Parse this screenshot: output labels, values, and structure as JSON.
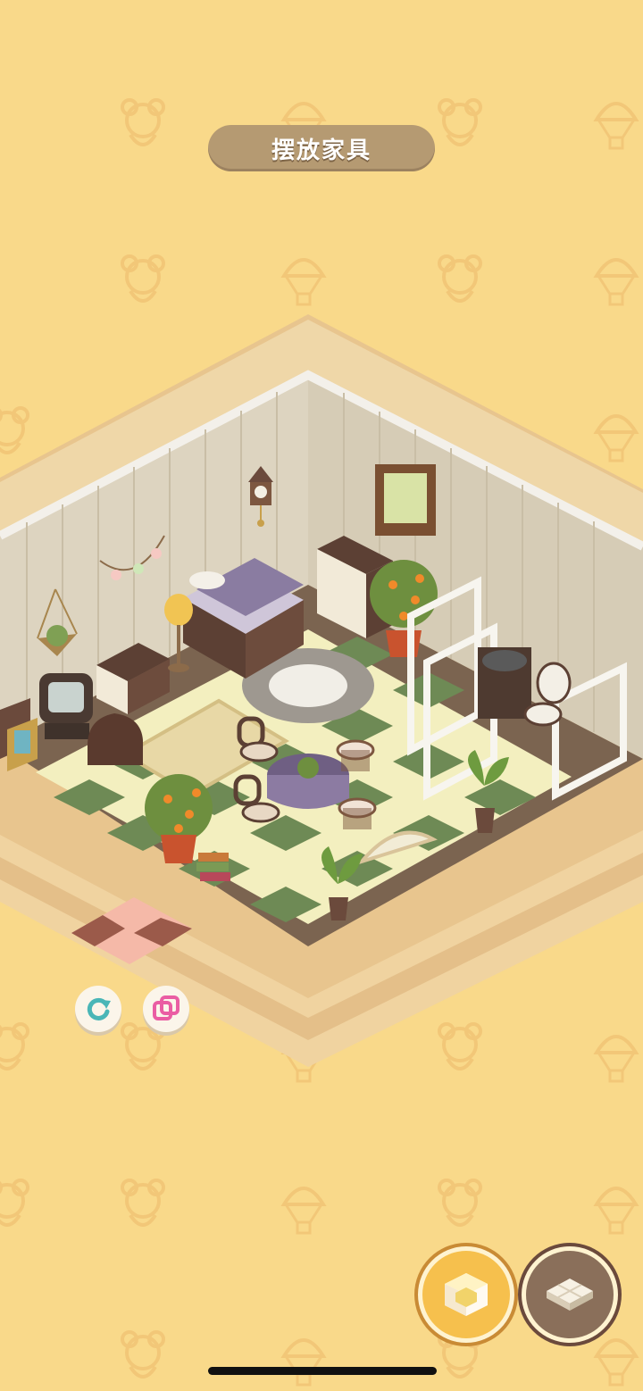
{
  "header": {
    "title": "摆放家具"
  },
  "colors": {
    "background": "#f9d98a",
    "pattern": "#f4c97a",
    "pill": "#b59a72",
    "floor_green": "#6e8a55",
    "floor_cream": "#f3efbf",
    "wall": "#ddd4c0",
    "accent_gold": "#f4c04a",
    "accent_brown": "#6b4a3c"
  },
  "icons": {
    "rotate": "rotate-icon",
    "flip": "flip-icon",
    "furniture_mode": "furniture-cube-icon",
    "floor_mode": "floor-tile-icon"
  }
}
